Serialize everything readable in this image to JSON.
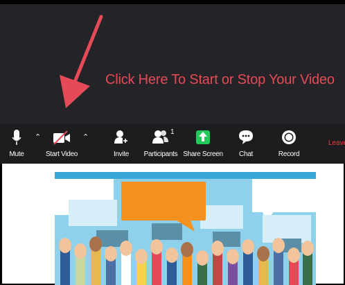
{
  "annotation": {
    "text": "Click Here To Start or Stop Your Video"
  },
  "toolbar": {
    "mute_label": "Mute",
    "start_video_label": "Start Video",
    "invite_label": "Invite",
    "participants_label": "Participants",
    "participants_count": "1",
    "share_screen_label": "Share Screen",
    "chat_label": "Chat",
    "record_label": "Record",
    "leave_label": "Leave"
  },
  "colors": {
    "annotation_red": "#e44b57",
    "toolbar_bg": "#1d1d20",
    "share_green": "#21c95b",
    "leave_red": "#e83a37",
    "sky_blue": "#8fd0ea",
    "speech_orange": "#f5911e"
  },
  "icons": [
    "microphone-icon",
    "caret-up-icon",
    "video-camera-off-icon",
    "invite-icon",
    "participants-icon",
    "share-screen-icon",
    "chat-icon",
    "record-icon"
  ]
}
